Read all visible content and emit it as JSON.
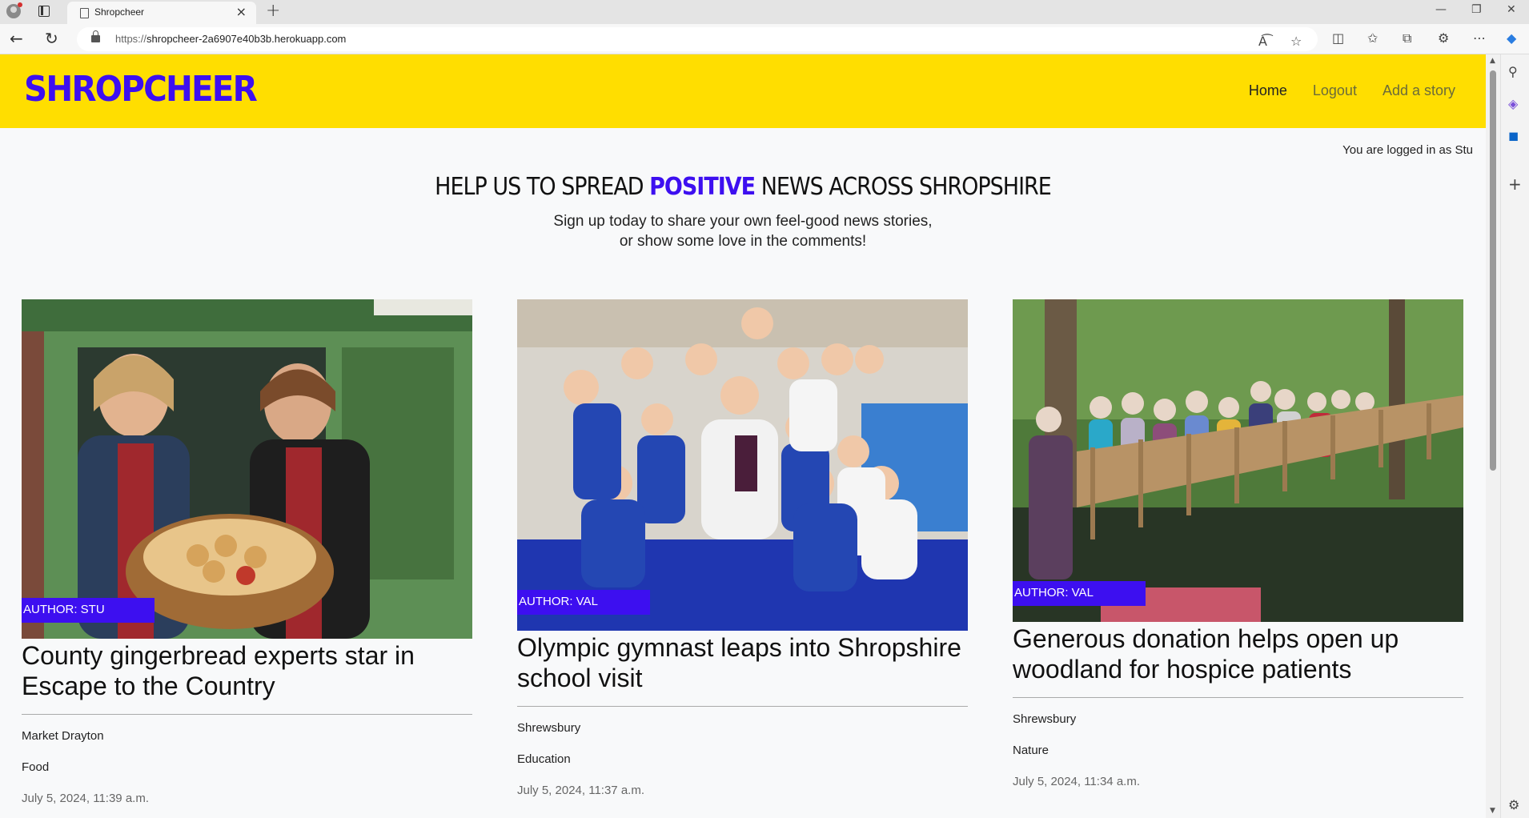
{
  "browser": {
    "tab_title": "Shropcheer",
    "url_proto": "https://",
    "url_host": "shropcheer-2a6907e40b3b.herokuapp.com",
    "icons": [
      "profile-icon",
      "tab-actions-icon",
      "close-tab-icon",
      "new-tab-icon",
      "back-icon",
      "refresh-icon",
      "lock-icon",
      "read-aloud-icon",
      "favorite-icon",
      "split-screen-icon",
      "favorites-icon",
      "collections-icon",
      "extensions-icon",
      "more-icon",
      "copilot-icon"
    ]
  },
  "header": {
    "logo": "SHROPCHEER",
    "nav": [
      "Home",
      "Logout",
      "Add a story"
    ],
    "bg_color": "#ffde00",
    "brand_color": "#3d0ff0"
  },
  "status": {
    "logged_in": "You are logged in as Stu"
  },
  "hero": {
    "title_pre": "HELP US TO SPREAD ",
    "title_em": "POSITIVE",
    "title_post": " NEWS ACROSS SHROPSHIRE",
    "sub_line1": "Sign up today to share your own feel-good news stories,",
    "sub_line2": "or show some love in the comments!"
  },
  "stories": [
    {
      "author": "AUTHOR: STU",
      "title": "County gingerbread experts star in Escape to the Country",
      "location": "Market Drayton",
      "category": "Food",
      "date": "July 5, 2024, 11:39 a.m.",
      "img_desc": "two women holding basket of gingerbread outside shop"
    },
    {
      "author": "AUTHOR: VAL",
      "title": "Olympic gymnast leaps into Shropshire school visit",
      "location": "Shrewsbury",
      "category": "Education",
      "date": "July 5, 2024, 11:37 a.m.",
      "img_desc": "school children with gymnast holding medal"
    },
    {
      "author": "AUTHOR: VAL",
      "title": "Generous donation helps open up woodland for hospice patients",
      "location": "Shrewsbury",
      "category": "Nature",
      "date": "July 5, 2024, 11:34 a.m.",
      "img_desc": "group of people on wooden bridge in woodland"
    }
  ]
}
